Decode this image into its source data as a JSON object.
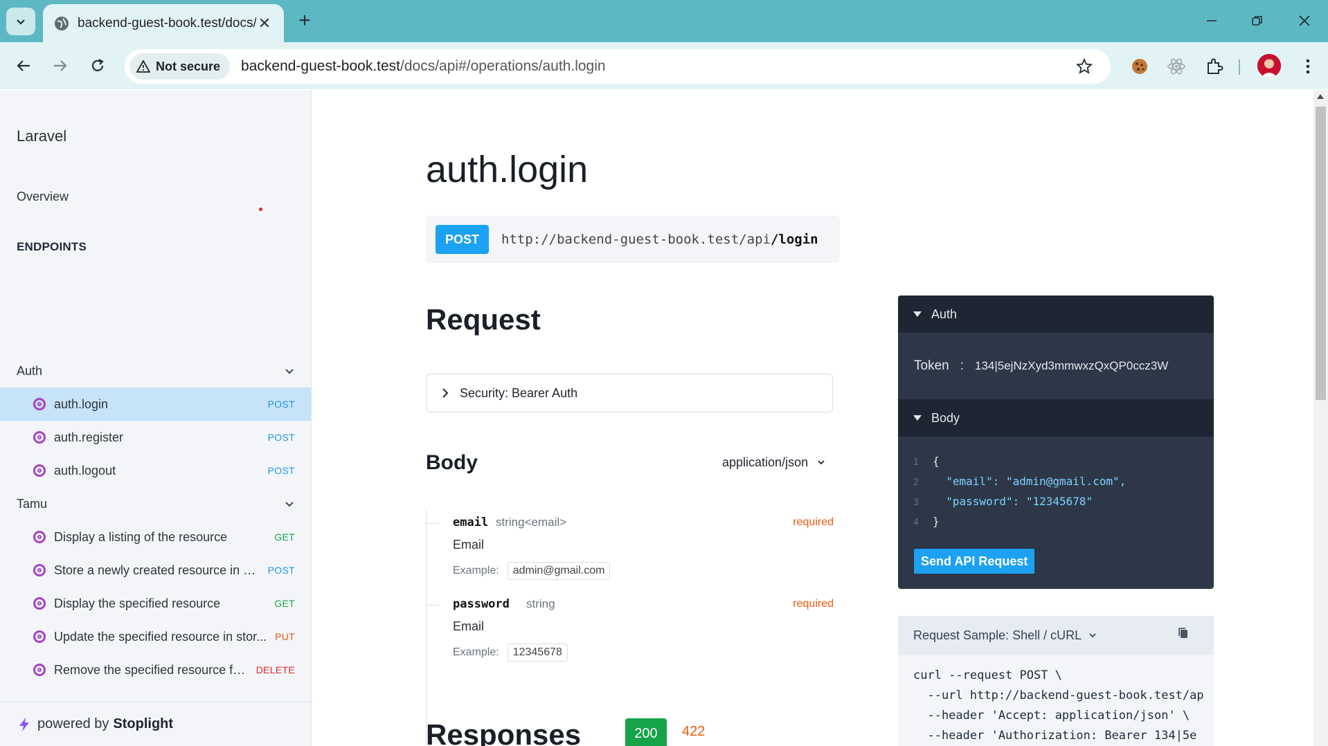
{
  "browser": {
    "tab_title": "backend-guest-book.test/docs/",
    "security_label": "Not secure",
    "url_host": "backend-guest-book.test",
    "url_path": "/docs/api#/operations/auth.login"
  },
  "sidebar": {
    "brand": "Laravel",
    "overview": "Overview",
    "section_title": "ENDPOINTS",
    "groups": [
      {
        "label": "Auth"
      },
      {
        "label": "Tamu"
      }
    ],
    "items": [
      {
        "label": "auth.login",
        "method": "POST"
      },
      {
        "label": "auth.register",
        "method": "POST"
      },
      {
        "label": "auth.logout",
        "method": "POST"
      },
      {
        "label": "Display a listing of the resource",
        "method": "GET"
      },
      {
        "label": "Store a newly created resource in st...",
        "method": "POST"
      },
      {
        "label": "Display the specified resource",
        "method": "GET"
      },
      {
        "label": "Update the specified resource in stor...",
        "method": "PUT"
      },
      {
        "label": "Remove the specified resource fro...",
        "method": "DELETE"
      }
    ],
    "powered_prefix": "powered by",
    "powered_brand": "Stoplight"
  },
  "main": {
    "title": "auth.login",
    "method": "POST",
    "endpoint_base": "http://backend-guest-book.test/api",
    "endpoint_path": "/login",
    "request_heading": "Request",
    "security_label": "Security: Bearer Auth",
    "body_heading": "Body",
    "content_type": "application/json",
    "fields": [
      {
        "name": "email",
        "type": "string<email>",
        "required": "required",
        "description": "Email",
        "example_label": "Example:",
        "example": "admin@gmail.com"
      },
      {
        "name": "password",
        "type": "string",
        "required": "required",
        "description": "Email",
        "example_label": "Example:",
        "example": "12345678"
      }
    ],
    "responses_heading": "Responses",
    "response_codes": [
      "200",
      "422"
    ]
  },
  "tryit": {
    "auth_heading": "Auth",
    "token_label": "Token",
    "token_value": "134|5ejNzXyd3mmwxzQxQP0ccz3W",
    "body_heading": "Body",
    "code_lines": [
      "{",
      "\"email\": \"admin@gmail.com\",",
      "\"password\": \"12345678\"",
      "}"
    ],
    "send_label": "Send API Request"
  },
  "sample": {
    "heading": "Request Sample: Shell / cURL",
    "lines": [
      "curl --request POST \\",
      "  --url http://backend-guest-book.test/ap",
      "  --header 'Accept: application/json' \\",
      "  --header 'Authorization: Bearer 134|5e"
    ]
  }
}
